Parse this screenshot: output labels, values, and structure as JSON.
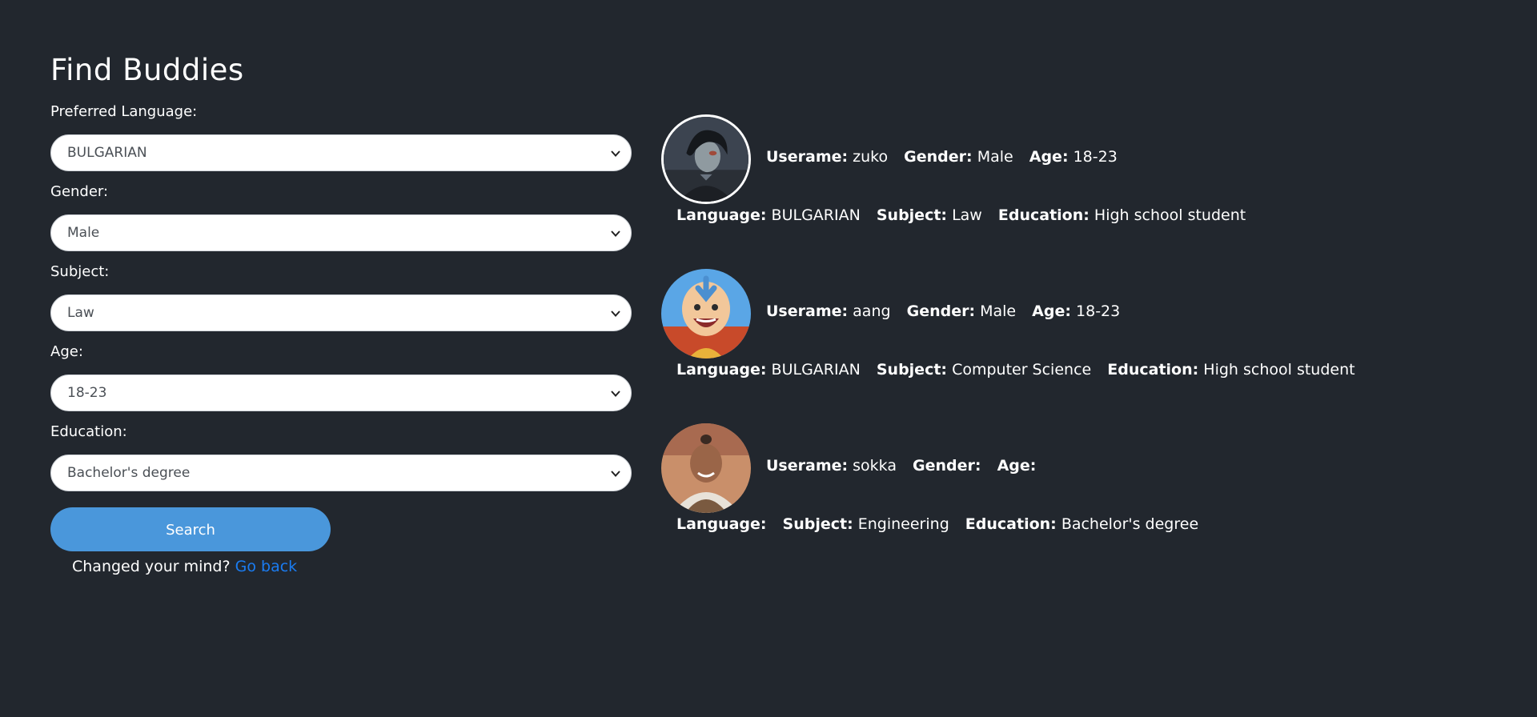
{
  "page": {
    "title": "Find Buddies"
  },
  "form": {
    "language": {
      "label": "Preferred Language:",
      "value": "BULGARIAN"
    },
    "gender": {
      "label": "Gender:",
      "value": "Male"
    },
    "subject": {
      "label": "Subject:",
      "value": "Law"
    },
    "age": {
      "label": "Age:",
      "value": "18-23"
    },
    "education": {
      "label": "Education:",
      "value": "Bachelor's degree"
    },
    "search_label": "Search",
    "back_prompt": "Changed your mind?",
    "back_link": "Go back"
  },
  "field_keys": {
    "username": "Userame:",
    "gender": "Gender:",
    "age": "Age:",
    "language": "Language:",
    "subject": "Subject:",
    "education": "Education:"
  },
  "results": [
    {
      "username": "zuko",
      "gender": "Male",
      "age": "18-23",
      "language": "BULGARIAN",
      "subject": "Law",
      "education": "High school student",
      "avatar_icon": "zuko-avatar"
    },
    {
      "username": "aang",
      "gender": "Male",
      "age": "18-23",
      "language": "BULGARIAN",
      "subject": "Computer Science",
      "education": "High school student",
      "avatar_icon": "aang-avatar"
    },
    {
      "username": "sokka",
      "gender": "",
      "age": "",
      "language": "",
      "subject": "Engineering",
      "education": "Bachelor's degree",
      "avatar_icon": "sokka-avatar"
    }
  ],
  "colors": {
    "background": "#22272e",
    "button": "#4a97db",
    "link": "#1a7cf2"
  },
  "icons": {
    "select_chevron": "chevron-down-icon"
  }
}
